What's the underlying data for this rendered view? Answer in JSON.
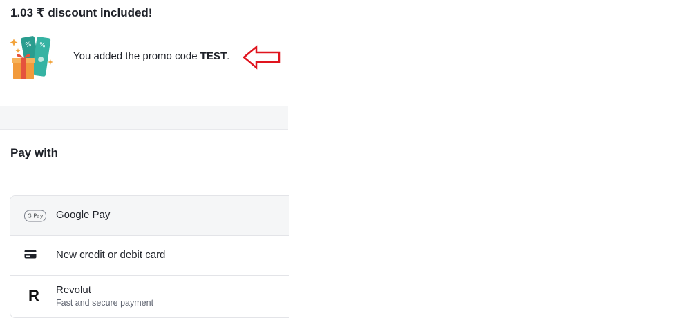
{
  "discount": {
    "title": "1.03 ₹ discount included!"
  },
  "promo": {
    "text_prefix": "You added the promo code ",
    "code": "TEST",
    "text_suffix": ".",
    "illustration_icon": "gift-tickets-illustration",
    "annotation_icon": "red-arrow-left-icon"
  },
  "pay_with": {
    "title": "Pay with"
  },
  "methods": [
    {
      "label": "Google Pay",
      "icon": "google-pay-icon",
      "badge": "G Pay",
      "selected": true
    },
    {
      "label": "New credit or debit card",
      "icon": "credit-card-icon",
      "selected": false
    },
    {
      "label": "Revolut",
      "subtitle": "Fast and secure payment",
      "icon": "revolut-icon",
      "badge": "R",
      "selected": false
    }
  ],
  "colors": {
    "text": "#1f2229",
    "selected_bg": "#f5f6f7",
    "annotation_red": "#e0141e",
    "ticket_teal": "#2a9d8f",
    "gift_orange": "#f29a3b"
  }
}
